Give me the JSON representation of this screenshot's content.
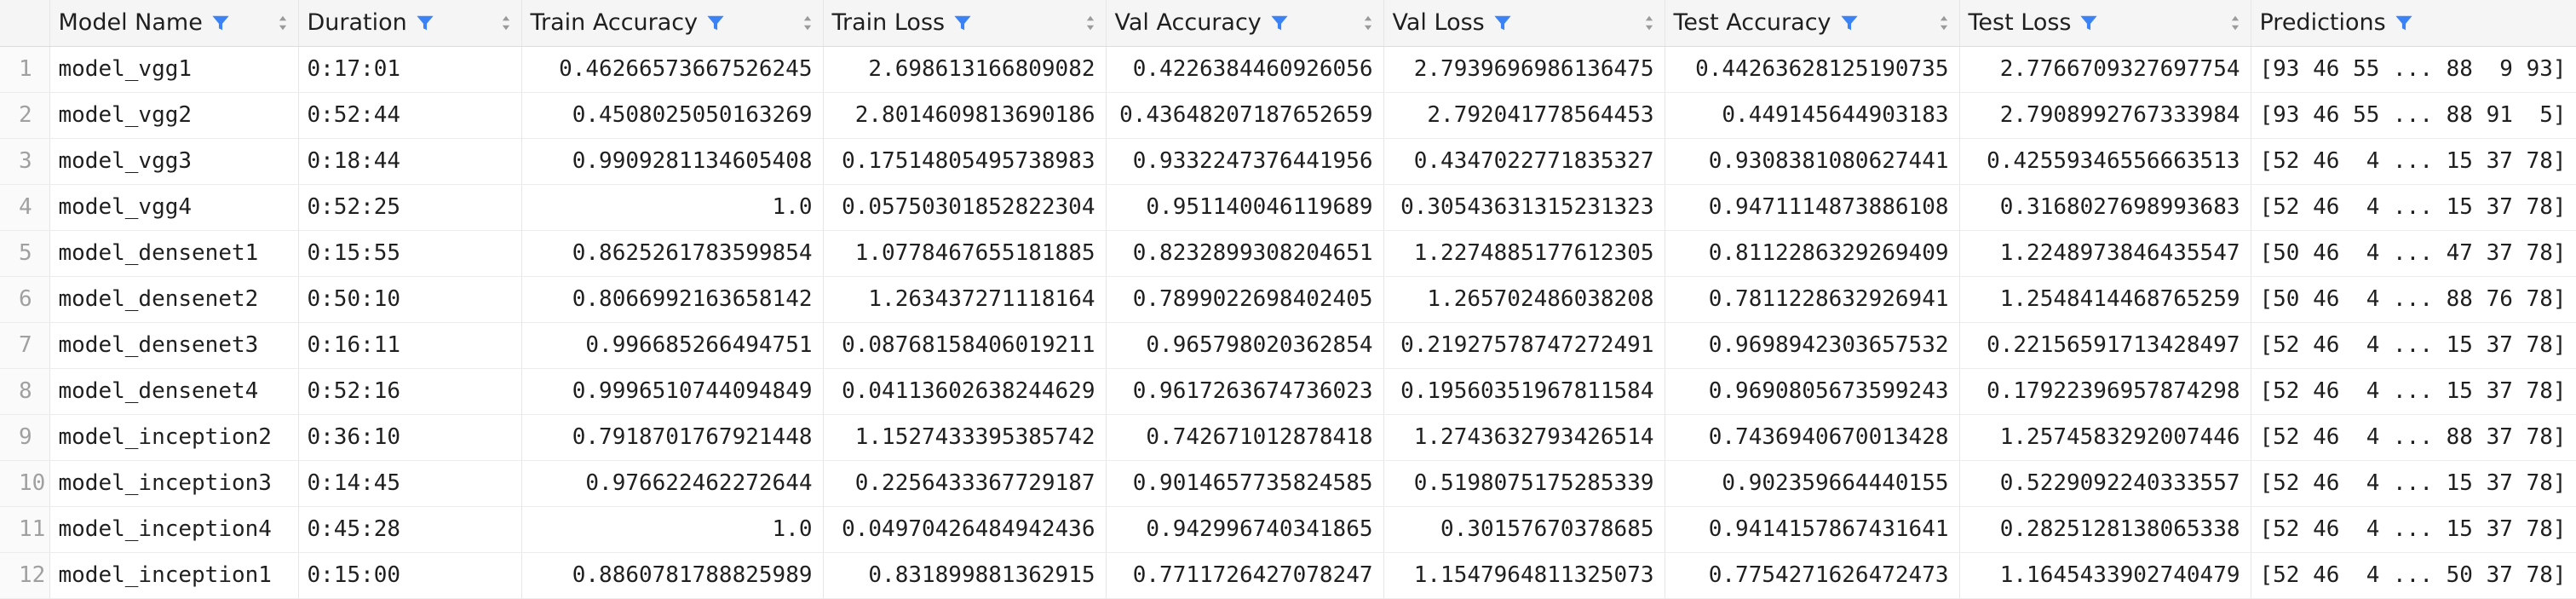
{
  "table": {
    "columns": [
      {
        "label": "Model Name",
        "filter": true
      },
      {
        "label": "Duration",
        "filter": true
      },
      {
        "label": "Train Accuracy",
        "filter": true
      },
      {
        "label": "Train Loss",
        "filter": true
      },
      {
        "label": "Val Accuracy",
        "filter": true
      },
      {
        "label": "Val Loss",
        "filter": true
      },
      {
        "label": "Test Accuracy",
        "filter": true
      },
      {
        "label": "Test Loss",
        "filter": true
      },
      {
        "label": "Predictions",
        "filter": true
      }
    ],
    "rows": [
      {
        "n": "1",
        "cells": [
          "model_vgg1",
          "0:17:01",
          "0.46266573667526245",
          "2.698613166809082",
          "0.4226384460926056",
          "2.7939696986136475",
          "0.44263628125190735",
          "2.7766709327697754",
          "[93 46 55 ... 88  9 93]"
        ]
      },
      {
        "n": "2",
        "cells": [
          "model_vgg2",
          "0:52:44",
          "0.4508025050163269",
          "2.8014609813690186",
          "0.43648207187652659",
          "2.792041778564453",
          "0.449145644903183",
          "2.7908992767333984",
          "[93 46 55 ... 88 91  5]"
        ]
      },
      {
        "n": "3",
        "cells": [
          "model_vgg3",
          "0:18:44",
          "0.9909281134605408",
          "0.17514805495738983",
          "0.9332247376441956",
          "0.4347022771835327",
          "0.9308381080627441",
          "0.42559346556663513",
          "[52 46  4 ... 15 37 78]"
        ]
      },
      {
        "n": "4",
        "cells": [
          "model_vgg4",
          "0:52:25",
          "1.0",
          "0.05750301852822304",
          "0.951140046119689",
          "0.30543631315231323",
          "0.9471114873886108",
          "0.3168027698993683",
          "[52 46  4 ... 15 37 78]"
        ]
      },
      {
        "n": "5",
        "cells": [
          "model_densenet1",
          "0:15:55",
          "0.8625261783599854",
          "1.0778467655181885",
          "0.8232899308204651",
          "1.2274885177612305",
          "0.8112286329269409",
          "1.2248973846435547",
          "[50 46  4 ... 47 37 78]"
        ]
      },
      {
        "n": "6",
        "cells": [
          "model_densenet2",
          "0:50:10",
          "0.8066992163658142",
          "1.263437271118164",
          "0.7899022698402405",
          "1.265702486038208",
          "0.7811228632926941",
          "1.2548414468765259",
          "[50 46  4 ... 88 76 78]"
        ]
      },
      {
        "n": "7",
        "cells": [
          "model_densenet3",
          "0:16:11",
          "0.996685266494751",
          "0.08768158406019211",
          "0.965798020362854",
          "0.21927578747272491",
          "0.9698942303657532",
          "0.22156591713428497",
          "[52 46  4 ... 15 37 78]"
        ]
      },
      {
        "n": "8",
        "cells": [
          "model_densenet4",
          "0:52:16",
          "0.9996510744094849",
          "0.04113602638244629",
          "0.9617263674736023",
          "0.19560351967811584",
          "0.9690805673599243",
          "0.17922396957874298",
          "[52 46  4 ... 15 37 78]"
        ]
      },
      {
        "n": "9",
        "cells": [
          "model_inception2",
          "0:36:10",
          "0.7918701767921448",
          "1.1527433395385742",
          "0.742671012878418",
          "1.2743632793426514",
          "0.7436940670013428",
          "1.2574583292007446",
          "[52 46  4 ... 88 37 78]"
        ]
      },
      {
        "n": "10",
        "cells": [
          "model_inception3",
          "0:14:45",
          "0.976622462272644",
          "0.2256433367729187",
          "0.9014657735824585",
          "0.5198075175285339",
          "0.902359664440155",
          "0.5229092240333557",
          "[52 46  4 ... 15 37 78]"
        ]
      },
      {
        "n": "11",
        "cells": [
          "model_inception4",
          "0:45:28",
          "1.0",
          "0.04970426484942436",
          "0.942996740341865",
          "0.30157670378685",
          "0.9414157867431641",
          "0.2825128138065338",
          "[52 46  4 ... 15 37 78]"
        ]
      },
      {
        "n": "12",
        "cells": [
          "model_inception1",
          "0:15:00",
          "0.8860781788825989",
          "0.831899881362915",
          "0.7711726427078247",
          "1.1547964811325073",
          "0.7754271626472473",
          "1.1645433902740479",
          "[52 46  4 ... 50 37 78]"
        ]
      }
    ]
  },
  "colors": {
    "filter_icon": "#3b82f6",
    "header_bg": "#f5f5f5",
    "row_number": "#a0a0a0",
    "grid": "#e6e6e6"
  },
  "icons": {
    "filter": "filter-funnel-icon",
    "sort": "sort-arrows-icon"
  }
}
